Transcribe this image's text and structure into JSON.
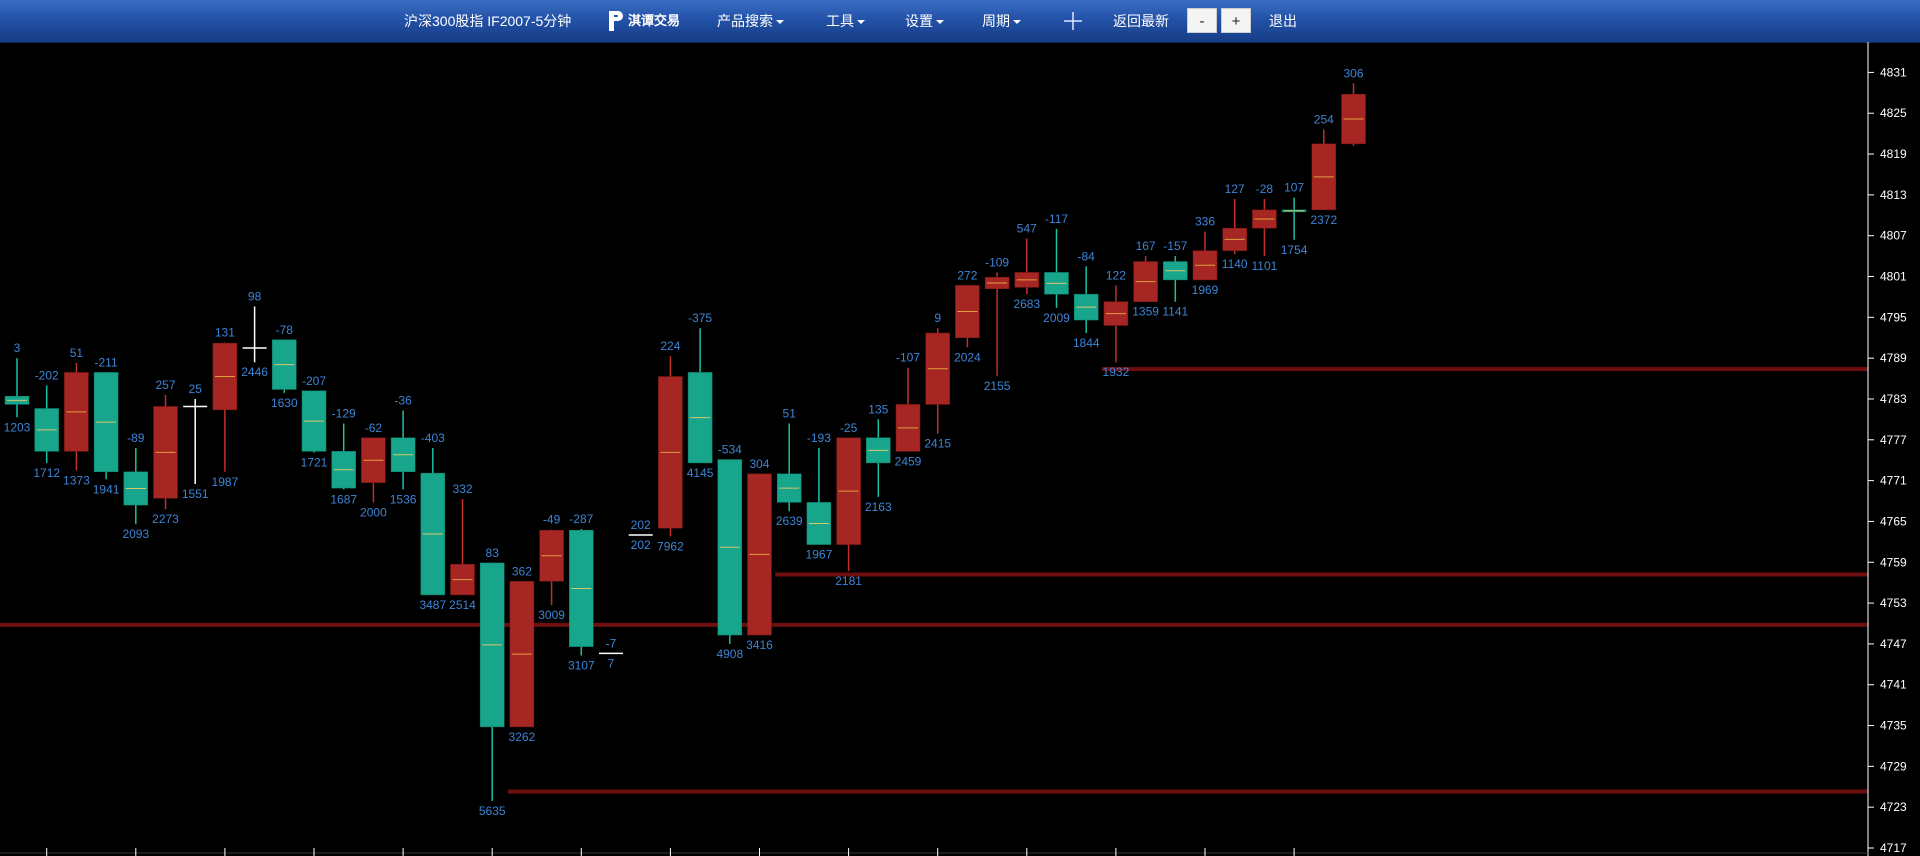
{
  "toolbar": {
    "symbol": "沪深300股指 IF2007-5分钟",
    "logo_text": "淇谭交易",
    "menu": [
      "产品搜索",
      "工具",
      "设置",
      "周期"
    ],
    "back_latest": "返回最新",
    "zoom_out": "-",
    "zoom_in": "+",
    "exit": "退出"
  },
  "colors": {
    "up": "#a52622",
    "down": "#17a58c",
    "label": "#3d84d6",
    "axis_text": "#ffffff",
    "background": "#000000",
    "toolbar": "#2352a8"
  },
  "chart_data": {
    "type": "candlestick",
    "title": "沪深300股指 IF2007-5分钟",
    "ylim": [
      4717,
      4834
    ],
    "y_ticks": [
      4831,
      4825,
      4819,
      4813,
      4807,
      4801,
      4795,
      4789,
      4783,
      4777,
      4771,
      4765,
      4759,
      4753,
      4747,
      4741,
      4735,
      4729,
      4723,
      4717
    ],
    "candles": [
      {
        "open": 4783.4,
        "high": 4789.0,
        "low": 4780.3,
        "close": 4782.2,
        "top": "3",
        "bottom": "1203"
      },
      {
        "open": 4781.6,
        "high": 4785.0,
        "low": 4773.6,
        "close": 4775.3,
        "top": "-202",
        "bottom": "1712"
      },
      {
        "open": 4775.3,
        "high": 4788.3,
        "low": 4772.5,
        "close": 4786.9,
        "top": "51",
        "bottom": "1373"
      },
      {
        "open": 4786.9,
        "high": 4786.9,
        "low": 4771.2,
        "close": 4772.3,
        "top": "-211",
        "bottom": "1941"
      },
      {
        "open": 4772.3,
        "high": 4775.8,
        "low": 4764.6,
        "close": 4767.4,
        "top": "-89",
        "bottom": "2093"
      },
      {
        "open": 4768.4,
        "high": 4783.6,
        "low": 4766.8,
        "close": 4781.9,
        "top": "257",
        "bottom": "2273"
      },
      {
        "open": 4781.9,
        "high": 4783.0,
        "low": 4770.5,
        "close": 4781.9,
        "top": "25",
        "bottom": "1551"
      },
      {
        "open": 4781.4,
        "high": 4791.3,
        "low": 4772.3,
        "close": 4791.2,
        "top": "131",
        "bottom": "1987"
      },
      {
        "open": 4790.5,
        "high": 4796.6,
        "low": 4788.4,
        "close": 4790.5,
        "top": "98",
        "bottom": "2446"
      },
      {
        "open": 4791.7,
        "high": 4791.7,
        "low": 4783.9,
        "close": 4784.4,
        "top": "-78",
        "bottom": "1630"
      },
      {
        "open": 4784.2,
        "high": 4784.2,
        "low": 4775.1,
        "close": 4775.3,
        "top": "-207",
        "bottom": "1721"
      },
      {
        "open": 4775.3,
        "high": 4779.4,
        "low": 4769.7,
        "close": 4769.9,
        "top": "-129",
        "bottom": "1687"
      },
      {
        "open": 4770.7,
        "high": 4777.3,
        "low": 4767.8,
        "close": 4777.3,
        "top": "-62",
        "bottom": "2000"
      },
      {
        "open": 4777.3,
        "high": 4781.3,
        "low": 4769.7,
        "close": 4772.3,
        "top": "-36",
        "bottom": "1536"
      },
      {
        "open": 4772.1,
        "high": 4775.8,
        "low": 4754.2,
        "close": 4754.2,
        "top": "-403",
        "bottom": "3487"
      },
      {
        "open": 4754.2,
        "high": 4768.3,
        "low": 4754.2,
        "close": 4758.7,
        "top": "332",
        "bottom": "2514"
      },
      {
        "open": 4758.9,
        "high": 4758.9,
        "low": 4723.9,
        "close": 4734.8,
        "top": "83",
        "bottom": "5635"
      },
      {
        "open": 4734.8,
        "high": 4756.2,
        "low": 4734.8,
        "close": 4756.2,
        "top": "362",
        "bottom": "3262"
      },
      {
        "open": 4756.2,
        "high": 4763.8,
        "low": 4752.7,
        "close": 4763.7,
        "top": "-49",
        "bottom": "3009"
      },
      {
        "open": 4763.7,
        "high": 4763.9,
        "low": 4745.3,
        "close": 4746.6,
        "top": "-287",
        "bottom": "3107"
      },
      {
        "open": 4745.6,
        "high": 4745.6,
        "low": 4745.6,
        "close": 4745.6,
        "top": "-7",
        "bottom": "7"
      },
      {
        "open": 4763.0,
        "high": 4763.0,
        "low": 4763.0,
        "close": 4763.0,
        "top": "202",
        "bottom": "202"
      },
      {
        "open": 4764.0,
        "high": 4789.3,
        "low": 4762.8,
        "close": 4786.3,
        "top": "224",
        "bottom": "7962"
      },
      {
        "open": 4786.9,
        "high": 4793.4,
        "low": 4773.6,
        "close": 4773.6,
        "top": "-375",
        "bottom": "4145"
      },
      {
        "open": 4774.1,
        "high": 4774.1,
        "low": 4747.0,
        "close": 4748.3,
        "top": "-534",
        "bottom": "4908"
      },
      {
        "open": 4748.3,
        "high": 4772.0,
        "low": 4748.3,
        "close": 4772.0,
        "top": "304",
        "bottom": "3416"
      },
      {
        "open": 4772.0,
        "high": 4779.4,
        "low": 4766.5,
        "close": 4767.8,
        "top": "51",
        "bottom": "2639"
      },
      {
        "open": 4767.8,
        "high": 4775.8,
        "low": 4761.6,
        "close": 4761.6,
        "top": "-193",
        "bottom": "1967"
      },
      {
        "open": 4761.6,
        "high": 4777.3,
        "low": 4757.7,
        "close": 4777.3,
        "top": "-25",
        "bottom": "2181"
      },
      {
        "open": 4777.3,
        "high": 4780.0,
        "low": 4768.6,
        "close": 4773.6,
        "top": "135",
        "bottom": "2163"
      },
      {
        "open": 4775.3,
        "high": 4787.6,
        "low": 4775.3,
        "close": 4782.2,
        "top": "-107",
        "bottom": "2459"
      },
      {
        "open": 4782.2,
        "high": 4793.4,
        "low": 4777.9,
        "close": 4792.7,
        "top": "9",
        "bottom": "2415"
      },
      {
        "open": 4792.0,
        "high": 4799.7,
        "low": 4790.6,
        "close": 4799.7,
        "top": "272",
        "bottom": "2024"
      },
      {
        "open": 4799.2,
        "high": 4801.6,
        "low": 4786.4,
        "close": 4800.9,
        "top": "-109",
        "bottom": "2155"
      },
      {
        "open": 4799.4,
        "high": 4806.6,
        "low": 4798.4,
        "close": 4801.6,
        "top": "547",
        "bottom": "2683"
      },
      {
        "open": 4801.6,
        "high": 4808.0,
        "low": 4796.4,
        "close": 4798.4,
        "top": "-117",
        "bottom": "2009"
      },
      {
        "open": 4798.4,
        "high": 4802.5,
        "low": 4792.7,
        "close": 4794.6,
        "top": "-84",
        "bottom": "1844"
      },
      {
        "open": 4793.8,
        "high": 4799.7,
        "low": 4788.4,
        "close": 4797.3,
        "top": "122",
        "bottom": "1932"
      },
      {
        "open": 4797.3,
        "high": 4804.0,
        "low": 4797.3,
        "close": 4803.2,
        "top": "167",
        "bottom": "1359"
      },
      {
        "open": 4803.2,
        "high": 4804.0,
        "low": 4797.3,
        "close": 4800.5,
        "top": "-157",
        "bottom": "1141"
      },
      {
        "open": 4800.5,
        "high": 4807.6,
        "low": 4800.5,
        "close": 4804.8,
        "top": "336",
        "bottom": "1969"
      },
      {
        "open": 4804.8,
        "high": 4812.4,
        "low": 4804.3,
        "close": 4808.1,
        "top": "127",
        "bottom": "1140"
      },
      {
        "open": 4808.1,
        "high": 4812.4,
        "low": 4804.0,
        "close": 4810.8,
        "top": "-28",
        "bottom": "1101"
      },
      {
        "open": 4810.8,
        "high": 4812.6,
        "low": 4806.4,
        "close": 4810.5,
        "top": "107",
        "bottom": "1754"
      },
      {
        "open": 4810.8,
        "high": 4822.6,
        "low": 4810.8,
        "close": 4820.5,
        "top": "254",
        "bottom": "2372"
      },
      {
        "open": 4820.5,
        "high": 4829.4,
        "low": 4820.2,
        "close": 4827.8,
        "top": "306",
        "bottom": ""
      }
    ],
    "levels": [
      {
        "price": 4787.4,
        "from_index": 37
      },
      {
        "price": 4757.2,
        "from_index": 26
      },
      {
        "price": 4749.8,
        "from_index": -1
      },
      {
        "price": 4725.3,
        "from_index": 17
      }
    ]
  }
}
